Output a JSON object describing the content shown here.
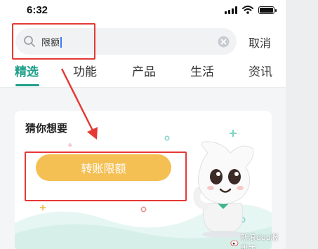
{
  "status_bar": {
    "time": "6:32",
    "icons": [
      "signal-icon",
      "wifi-icon",
      "battery-icon"
    ]
  },
  "search": {
    "query": "限额",
    "cancel_label": "取消",
    "icons": [
      "search-icon",
      "clear-icon"
    ]
  },
  "tabs": [
    {
      "label": "精选",
      "active": true
    },
    {
      "label": "功能",
      "active": false
    },
    {
      "label": "产品",
      "active": false
    },
    {
      "label": "生活",
      "active": false
    },
    {
      "label": "资讯",
      "active": false
    }
  ],
  "card": {
    "title": "猜你想要",
    "cta_label": "转账限额"
  },
  "watermark": {
    "text": "新浪dou服惠本",
    "icon": "weibo-icon"
  },
  "colors": {
    "accent": "#1fa08b",
    "cta": "#f4c054",
    "annotation": "#e53935",
    "caret": "#3a7bff"
  }
}
